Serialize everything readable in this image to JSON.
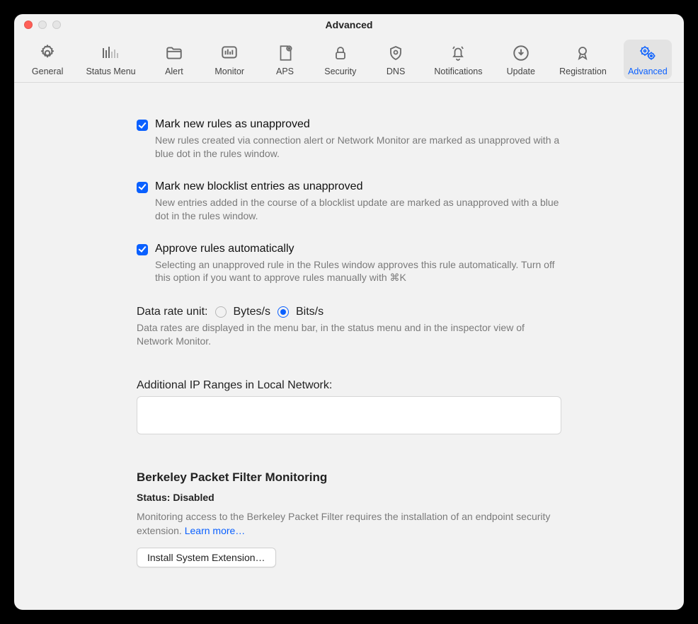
{
  "window": {
    "title": "Advanced"
  },
  "toolbar": {
    "items": [
      {
        "id": "general",
        "label": "General"
      },
      {
        "id": "status-menu",
        "label": "Status Menu"
      },
      {
        "id": "alert",
        "label": "Alert"
      },
      {
        "id": "monitor",
        "label": "Monitor"
      },
      {
        "id": "aps",
        "label": "APS"
      },
      {
        "id": "security",
        "label": "Security"
      },
      {
        "id": "dns",
        "label": "DNS"
      },
      {
        "id": "notifications",
        "label": "Notifications"
      },
      {
        "id": "update",
        "label": "Update"
      },
      {
        "id": "registration",
        "label": "Registration"
      },
      {
        "id": "advanced",
        "label": "Advanced"
      }
    ],
    "active": "advanced"
  },
  "options": {
    "markRules": {
      "label": "Mark new rules as unapproved",
      "desc": "New rules created via connection alert or Network Monitor are marked as unapproved with a blue dot in the rules window.",
      "checked": true
    },
    "markBlocklist": {
      "label": "Mark new blocklist entries as unapproved",
      "desc": "New entries added in the course of a blocklist update are marked as unapproved with a blue dot in the rules window.",
      "checked": true
    },
    "approveAuto": {
      "label": "Approve rules automatically",
      "desc": "Selecting an unapproved rule in the Rules window approves this rule automatically. Turn off this option if you want to approve rules manually with ⌘K",
      "checked": true
    }
  },
  "dataRate": {
    "label": "Data rate unit:",
    "bytes": "Bytes/s",
    "bits": "Bits/s",
    "selected": "bits",
    "desc": "Data rates are displayed in the menu bar, in the status menu and in the inspector view of Network Monitor."
  },
  "ipRanges": {
    "label": "Additional IP Ranges in Local Network:",
    "value": ""
  },
  "bpf": {
    "title": "Berkeley Packet Filter Monitoring",
    "statusLabel": "Status: Disabled",
    "desc": "Monitoring access to the Berkeley Packet Filter requires the installation of an endpoint security extension. ",
    "learnMore": "Learn more…",
    "installBtn": "Install System Extension…"
  }
}
